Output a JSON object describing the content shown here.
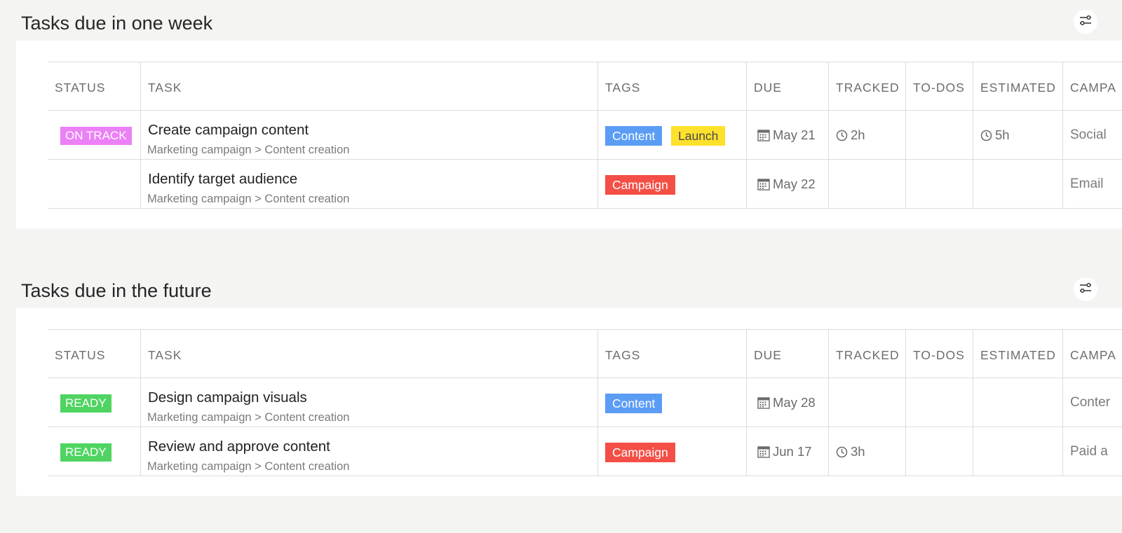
{
  "colors": {
    "on_track": "#ec80f6",
    "ready": "#4fd461",
    "content": "#5b9cf5",
    "launch": "#fde12c",
    "campaign": "#f44f46"
  },
  "icons": {
    "filter": "sliders-icon",
    "due": "calendar-icon",
    "time": "clock-icon"
  },
  "columns": {
    "status": "STATUS",
    "task": "TASK",
    "tags": "TAGS",
    "due": "DUE",
    "tracked": "TRACKED",
    "todos": "TO-DOS",
    "estimated": "ESTIMATED",
    "campaign": "CAMPA"
  },
  "sections": [
    {
      "title": "Tasks due in one week",
      "rows": [
        {
          "status": "ON TRACK",
          "task": "Create campaign content",
          "path": "Marketing campaign > Content creation",
          "tags": [
            "Content",
            "Launch"
          ],
          "due": "May 21",
          "tracked": "2h",
          "todos": "",
          "estimated": "5h",
          "campaign": "Social"
        },
        {
          "status": "",
          "task": "Identify target audience",
          "path": "Marketing campaign > Content creation",
          "tags": [
            "Campaign"
          ],
          "due": "May 22",
          "tracked": "",
          "todos": "",
          "estimated": "",
          "campaign": "Email"
        }
      ]
    },
    {
      "title": "Tasks due in the future",
      "rows": [
        {
          "status": "READY",
          "task": "Design campaign visuals",
          "path": "Marketing campaign > Content creation",
          "tags": [
            "Content"
          ],
          "due": "May 28",
          "tracked": "",
          "todos": "",
          "estimated": "",
          "campaign": "Conter"
        },
        {
          "status": "READY",
          "task": "Review and approve content",
          "path": "Marketing campaign > Content creation",
          "tags": [
            "Campaign"
          ],
          "due": "Jun 17",
          "tracked": "3h",
          "todos": "",
          "estimated": "",
          "campaign": "Paid a"
        }
      ]
    }
  ]
}
